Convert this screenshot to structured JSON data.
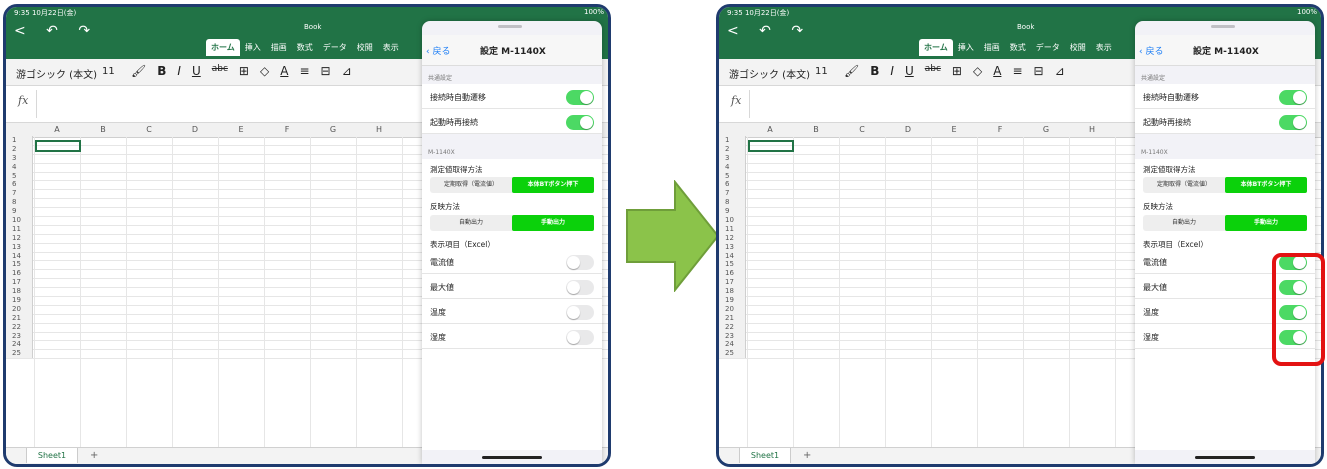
{
  "status": {
    "time": "9:35  10月22日(金)",
    "battery": "100%"
  },
  "app": {
    "doc_name": "Book",
    "nav_icons": "<  ↶  ↷",
    "ribbon_tabs": [
      "ホーム",
      "挿入",
      "描画",
      "数式",
      "データ",
      "校閲",
      "表示"
    ]
  },
  "toolbar": {
    "font": "游ゴシック (本文)",
    "size": "11",
    "tools": [
      "🖌",
      "B",
      "I",
      "U",
      "abc",
      "⊞",
      "◇",
      "A",
      "≡",
      "⊟",
      "⊿"
    ]
  },
  "formula": {
    "fx": "fx"
  },
  "grid": {
    "columns": [
      "A",
      "B",
      "C",
      "D",
      "E",
      "F",
      "G",
      "H"
    ],
    "rows": [
      "1",
      "2",
      "3",
      "4",
      "5",
      "6",
      "7",
      "8",
      "9",
      "10",
      "11",
      "12",
      "13",
      "14",
      "15",
      "16",
      "17",
      "18",
      "19",
      "20",
      "21",
      "22",
      "23",
      "24",
      "25"
    ]
  },
  "sheet": {
    "tab": "Sheet1",
    "add": "+"
  },
  "panel": {
    "back": "戻る",
    "title": "設定 M-1140X",
    "section_common": "共通設定",
    "toggle_auto": "接続時自動遷移",
    "toggle_reconnect": "起動時再接続",
    "section_device": "M-1140X",
    "measure_label": "測定値取得方法",
    "measure_options": [
      "定期取得（電流値）",
      "本体BTボタン押下"
    ],
    "output_label": "反映方法",
    "output_options": [
      "自動出力",
      "手動出力"
    ],
    "items_label": "表示項目（Excel）",
    "items_left": [
      "電流値",
      "最大値",
      "温度",
      "湿度"
    ],
    "items_right": [
      "電流値",
      "最大値",
      "温度",
      "湿度"
    ]
  },
  "colors": {
    "excel_green": "#217346",
    "toggle_on": "#4cd964",
    "segment_on": "#0bd10b",
    "arrow": "#8bc34a",
    "highlight": "#e31212"
  }
}
